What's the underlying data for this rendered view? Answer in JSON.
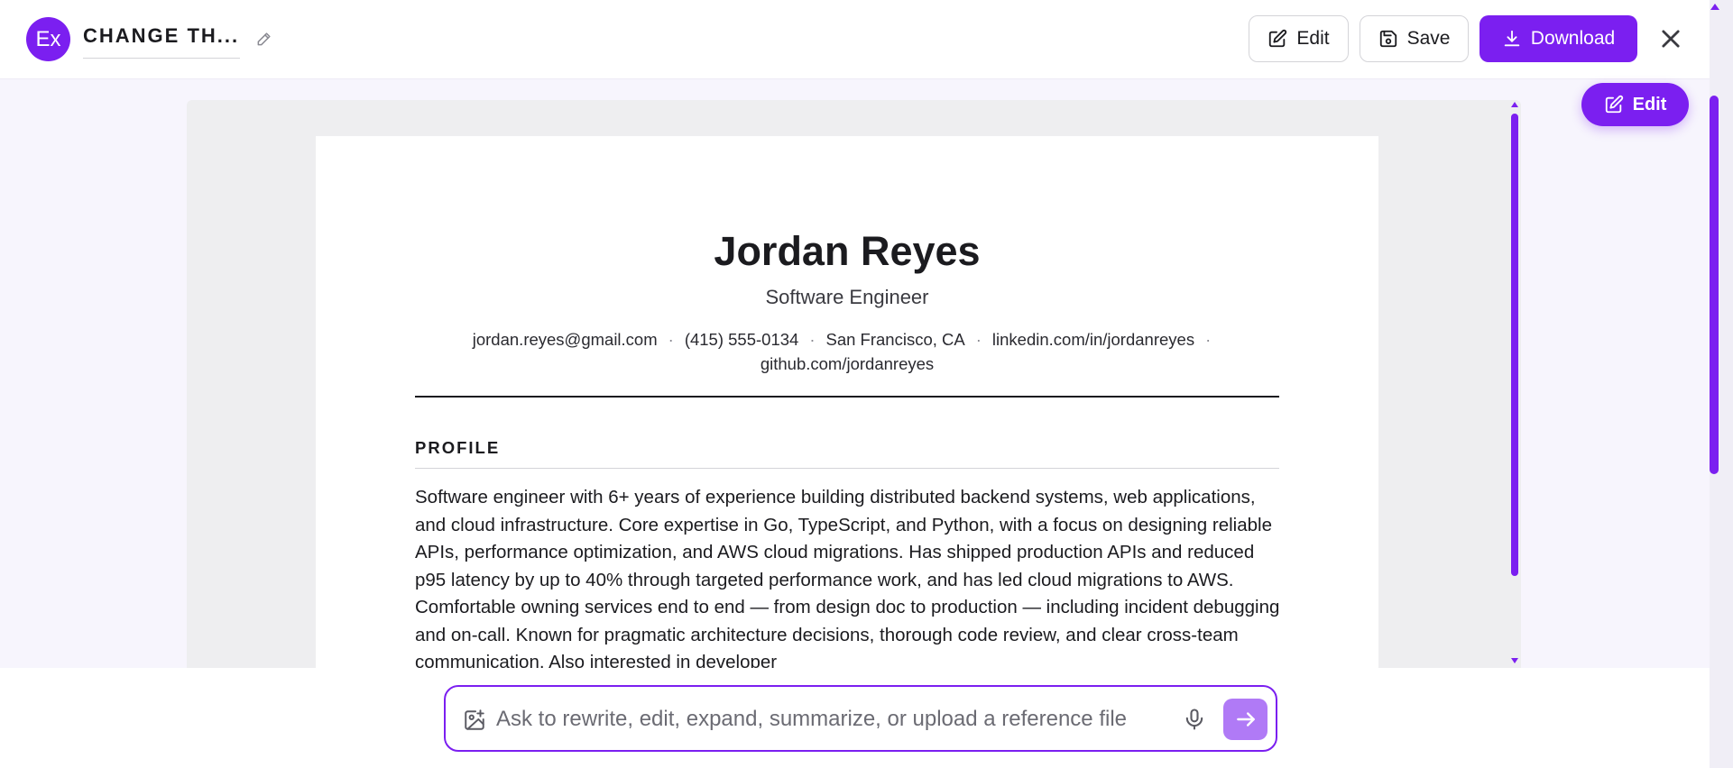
{
  "header": {
    "logo_text": "Ex",
    "doc_title": "CHANGE TH...",
    "edit_label": "Edit",
    "save_label": "Save",
    "download_label": "Download"
  },
  "floating": {
    "edit_label": "Edit"
  },
  "resume": {
    "name": "Jordan Reyes",
    "role": "Software Engineer",
    "contact": {
      "email": "jordan.reyes@gmail.com",
      "phone": "(415) 555-0134",
      "location": "San Francisco, CA",
      "linkedin": "linkedin.com/in/jordanreyes",
      "github": "github.com/jordanreyes",
      "separator": "·"
    },
    "profile_heading": "PROFILE",
    "profile_text": "Software engineer with 6+ years of experience building distributed backend systems, web applications, and cloud infrastructure. Core expertise in Go, TypeScript, and Python, with a focus on designing reliable APIs, performance optimization, and AWS cloud migrations. Has shipped production APIs and reduced p95 latency by up to 40% through targeted performance work, and has led cloud migrations to AWS. Comfortable owning services end to end — from design doc to production — including incident debugging and on-call. Known for pragmatic architecture decisions, thorough code review, and clear cross-team communication. Also interested in developer"
  },
  "prompt": {
    "placeholder": "Ask to rewrite, edit, expand, summarize, or upload a reference file"
  },
  "colors": {
    "accent": "#7b1ff0",
    "send_button": "#b07af6",
    "canvas_bg": "#eeeef0"
  },
  "icons": {
    "title_edit": "pencil-icon",
    "edit": "edit-square-icon",
    "save": "floppy-disk-icon",
    "download": "download-icon",
    "close": "close-icon",
    "image_upload": "image-add-icon",
    "mic": "microphone-icon",
    "send": "arrow-right-icon"
  }
}
